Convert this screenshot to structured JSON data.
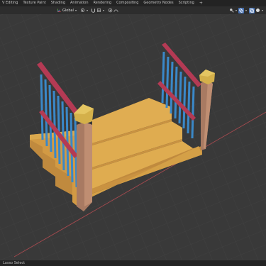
{
  "workspace_tabs": [
    "V Editing",
    "Texture Paint",
    "Shading",
    "Animation",
    "Rendering",
    "Compositing",
    "Geometry Nodes",
    "Scripting"
  ],
  "add_tab_label": "+",
  "header": {
    "orientation_label": "Global",
    "orientation_icon": "axes-icon",
    "selected_color": "#4772b3"
  },
  "status": {
    "left_text": "Lasso Select"
  },
  "colors": {
    "grid_background": "#393939",
    "x_axis": "#a54a4f",
    "stair_wood": "#d9a64a",
    "post": "#b08068",
    "post_cap": "#d4b04a",
    "handrail": "#b43a54",
    "baluster": "#3a88c8"
  }
}
